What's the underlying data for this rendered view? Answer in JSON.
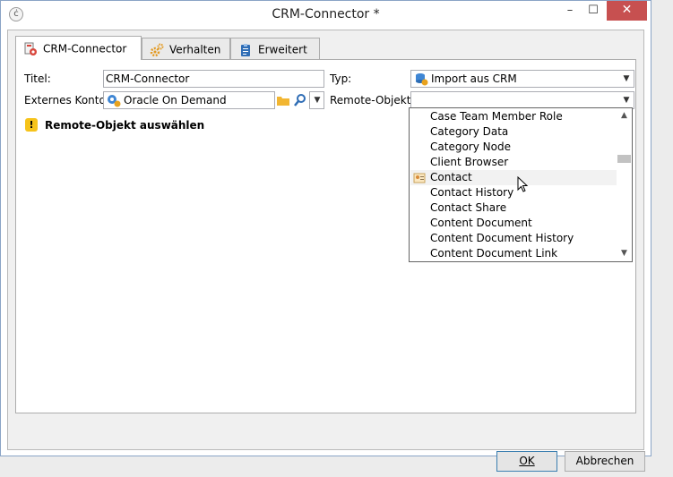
{
  "window": {
    "title": "CRM-Connector *",
    "minimize": "–",
    "maximize": "☐",
    "close": "✕"
  },
  "tabs": [
    {
      "label": "CRM-Connector",
      "icon": "crm-connector-icon",
      "active": true
    },
    {
      "label": "Verhalten",
      "icon": "gears-icon",
      "active": false
    },
    {
      "label": "Erweitert",
      "icon": "clipboard-icon",
      "active": false
    }
  ],
  "form": {
    "title_label": "Titel:",
    "title_value": "CRM-Connector",
    "type_label": "Typ:",
    "type_value": "Import aus CRM",
    "account_label": "Externes Konto:",
    "account_value": "Oracle On Demand",
    "remote_label": "Remote-Objekt:",
    "remote_value": ""
  },
  "warning": {
    "text": "Remote-Objekt auswählen",
    "icon": "!"
  },
  "dropdown": {
    "items": [
      "Case Team Member Role",
      "Category Data",
      "Category Node",
      "Client Browser",
      "Contact",
      "Contact History",
      "Contact Share",
      "Content Document",
      "Content Document History",
      "Content Document Link"
    ],
    "hovered_index": 4
  },
  "buttons": {
    "ok": "OK",
    "cancel": "Abbrechen"
  },
  "colors": {
    "close_button": "#c75050",
    "warning": "#f6c31a",
    "ok_border": "#3c7fb1"
  }
}
